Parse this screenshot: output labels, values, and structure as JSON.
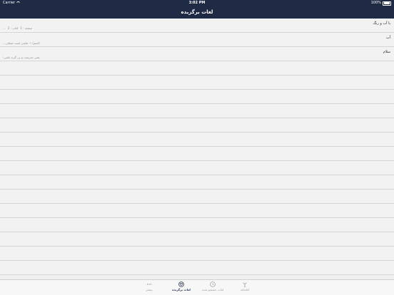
{
  "status_bar": {
    "carrier": "Carrier",
    "time": "3:02 PM",
    "battery_text": "100%"
  },
  "nav": {
    "title": "لغات برگزیده"
  },
  "entries": [
    {
      "word": "با آب و رنگ",
      "meaning": "",
      "ref_volume": "کتاب : 2",
      "ref_page": "صفحه : 1",
      "ref_more": "..."
    },
    {
      "word": "آب",
      "meaning": "(اسم) ۱- مایعی است شفاف...",
      "ref_volume": "",
      "ref_page": "",
      "ref_more": ""
    },
    {
      "word": "سلام",
      "meaning": "یعنی تندرست و بی گزند باشی؛",
      "ref_volume": "",
      "ref_page": "",
      "ref_more": ""
    }
  ],
  "tabs": [
    {
      "label": "بیشتر",
      "icon": "more-icon"
    },
    {
      "label": "لغات برگزیده",
      "icon": "heart-icon"
    },
    {
      "label": "لغات جستجو شده",
      "icon": "history-icon"
    },
    {
      "label": "کتابخانه",
      "icon": "library-icon"
    }
  ],
  "colors": {
    "bar": "#1f2a44",
    "row_bg": "#f2f2f2",
    "separator": "#d6d6d6"
  }
}
